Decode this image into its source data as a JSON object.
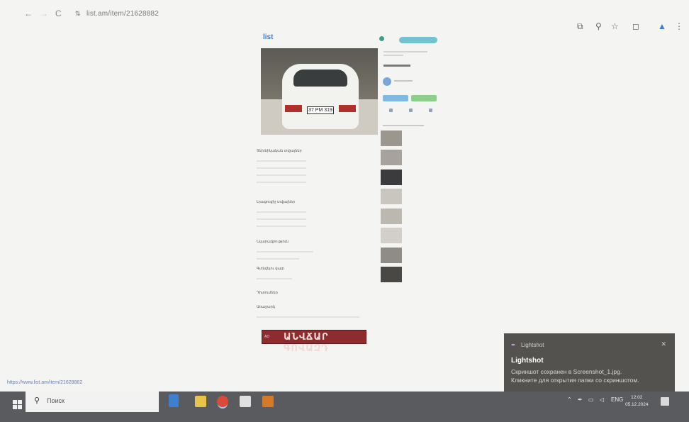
{
  "browser": {
    "back_icon": "←",
    "forward_icon": "→",
    "reload_icon": "C",
    "site_icon": "⇅",
    "url": "list.am/item/21628882",
    "toolbar_icons": [
      "translate-icon",
      "zoom-icon",
      "bookmark-star-icon",
      "extensions-icon",
      "profile-icon",
      "menu-icon"
    ],
    "toolbar_glyphs": [
      "⧉",
      "⚲",
      "☆",
      "◻",
      "▲",
      "⋮"
    ]
  },
  "listing": {
    "logo": "list",
    "plate": "37 PM 319",
    "section_headers": [
      "Տեխնիկական տվյալներ",
      "Լրացուցիչ տվյալներ",
      "Նկարագրություն",
      "Գտնվելու վայր",
      "Դիտումներ",
      "Առաջարկ"
    ],
    "banner_text": "ԱՆՎՃԱՐ ԳՈՎԱԶԴ",
    "banner_tag": "AD"
  },
  "notification": {
    "app": "Lightshot",
    "title": "Lightshot",
    "line1": "Скриншот сохранен в Screenshot_1.jpg.",
    "line2": "Кликните для открытия папки со скриншотом.",
    "close_icon": "✕"
  },
  "status_bar_url": "https://www.list.am/item/21628882",
  "taskbar": {
    "search_placeholder": "Поиск",
    "search_icon": "⚲",
    "lang": "ENG",
    "time": "12:02",
    "date": "05.12.2024",
    "app_colors": [
      "#3f7fd0",
      "#e8c44a",
      "#d94a38",
      "#e0e0e0",
      "#d67a2a"
    ]
  }
}
